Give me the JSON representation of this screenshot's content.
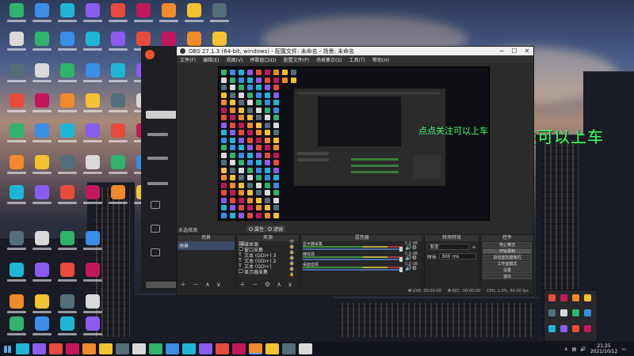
{
  "overlay_text": "点点关注可以上车",
  "obs": {
    "title": "OBS 27.1.3 (64-bit, windows) - 配置文件: 未命名 - 场景: 未命名",
    "menu": [
      "文件(F)",
      "编辑(E)",
      "视图(V)",
      "停靠窗口(D)",
      "配置文件(P)",
      "场景集合(S)",
      "工具(T)",
      "帮助(H)"
    ],
    "preview_overlay_text": "点点关注可以上车",
    "below_preview": {
      "label": "未选择源",
      "properties": "属性",
      "filters": "滤镜"
    },
    "docks": {
      "scenes": {
        "title": "场景",
        "items": [
          "场景"
        ]
      },
      "sources": {
        "title": "来源",
        "items": [
          {
            "icon": "🖼",
            "name": "媒体源"
          },
          {
            "icon": "🖵",
            "name": "窗口采集"
          },
          {
            "icon": "T",
            "name": "文本 (GDI+) 3"
          },
          {
            "icon": "T",
            "name": "文本 (GDI+) 2"
          },
          {
            "icon": "T",
            "name": "文本 (GDI+)"
          },
          {
            "icon": "🖵",
            "name": "显示器采集"
          }
        ]
      },
      "mixer": {
        "title": "混音器",
        "channels": [
          {
            "name": "显示器采集",
            "db": "0.0 dB"
          },
          {
            "name": "媒体源",
            "db": "0.0 dB"
          },
          {
            "name": "桌面音频",
            "db": "0.0 dB"
          }
        ]
      },
      "transitions": {
        "title": "转场特效",
        "type": "渐变",
        "duration_label": "时长",
        "duration": "300 ms"
      },
      "controls": {
        "title": "控件",
        "buttons": [
          "停止推流",
          "开始录制",
          "启动虚拟摄像机",
          "工作室模式",
          "设置",
          "退出"
        ]
      }
    },
    "status": {
      "live": "LIVE: 00:00:00",
      "rec": "REC: 00:00:00",
      "cpu": "CPU: 1.0%, 60.00 fps"
    }
  },
  "clock": {
    "time": "21:25",
    "date": "2021/10/12"
  },
  "colors": {
    "overlay_green": "#3dff6a",
    "obs_dark": "#2b2b2b",
    "accent_blue": "#5aa6e8"
  }
}
